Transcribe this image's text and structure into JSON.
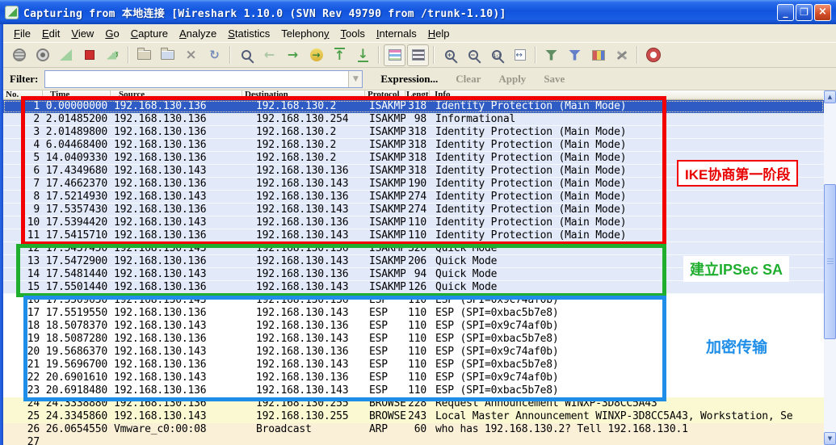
{
  "window": {
    "title": "Capturing from 本地连接    [Wireshark 1.10.0  (SVN Rev 49790 from /trunk-1.10)]",
    "controls": {
      "minimize": "_",
      "maximize": "❐",
      "close": "×"
    }
  },
  "menu": {
    "items": [
      {
        "pre": "",
        "key": "F",
        "post": "ile"
      },
      {
        "pre": "",
        "key": "E",
        "post": "dit"
      },
      {
        "pre": "",
        "key": "V",
        "post": "iew"
      },
      {
        "pre": "",
        "key": "G",
        "post": "o"
      },
      {
        "pre": "",
        "key": "C",
        "post": "apture"
      },
      {
        "pre": "",
        "key": "A",
        "post": "nalyze"
      },
      {
        "pre": "",
        "key": "S",
        "post": "tatistics"
      },
      {
        "pre": "Telephon",
        "key": "y",
        "post": ""
      },
      {
        "pre": "",
        "key": "T",
        "post": "ools"
      },
      {
        "pre": "",
        "key": "I",
        "post": "nternals"
      },
      {
        "pre": "",
        "key": "H",
        "post": "elp"
      }
    ]
  },
  "toolbar": {
    "items": [
      {
        "name": "list-interfaces-icon"
      },
      {
        "name": "capture-options-icon"
      },
      {
        "name": "start-capture-icon"
      },
      {
        "name": "stop-capture-icon"
      },
      {
        "name": "restart-capture-icon"
      },
      {
        "name": "separator"
      },
      {
        "name": "open-file-icon"
      },
      {
        "name": "save-file-icon"
      },
      {
        "name": "close-file-icon"
      },
      {
        "name": "reload-file-icon"
      },
      {
        "name": "separator"
      },
      {
        "name": "find-packet-icon"
      },
      {
        "name": "go-back-icon"
      },
      {
        "name": "go-forward-icon"
      },
      {
        "name": "go-to-packet-icon"
      },
      {
        "name": "go-to-top-icon"
      },
      {
        "name": "go-to-bottom-icon"
      },
      {
        "name": "separator"
      },
      {
        "name": "colorize-icon"
      },
      {
        "name": "auto-scroll-icon"
      },
      {
        "name": "separator"
      },
      {
        "name": "zoom-in-icon"
      },
      {
        "name": "zoom-out-icon"
      },
      {
        "name": "zoom-normal-icon"
      },
      {
        "name": "resize-columns-icon"
      },
      {
        "name": "separator"
      },
      {
        "name": "capture-filter-icon"
      },
      {
        "name": "display-filter-icon"
      },
      {
        "name": "coloring-rules-icon"
      },
      {
        "name": "preferences-icon"
      },
      {
        "name": "separator"
      },
      {
        "name": "help-icon"
      }
    ]
  },
  "filter": {
    "label": "Filter:",
    "value": "",
    "buttons": [
      {
        "label": "Expression...",
        "enabled": true
      },
      {
        "label": "Clear",
        "enabled": false
      },
      {
        "label": "Apply",
        "enabled": false
      },
      {
        "label": "Save",
        "enabled": false
      }
    ]
  },
  "packet_list": {
    "columns": [
      {
        "id": "no",
        "label": "No."
      },
      {
        "id": "time",
        "label": "Time"
      },
      {
        "id": "source",
        "label": "Source"
      },
      {
        "id": "destination",
        "label": "Destination"
      },
      {
        "id": "protocol",
        "label": "Protocol"
      },
      {
        "id": "length",
        "label": "Length"
      },
      {
        "id": "info",
        "label": "Info"
      }
    ],
    "rows": [
      {
        "no": "1",
        "time": "0.00000000",
        "source": "192.168.130.136",
        "destination": "192.168.130.2",
        "protocol": "ISAKMP",
        "length": "318",
        "info": "Identity Protection (Main Mode)",
        "type": "isakmp",
        "selected": true
      },
      {
        "no": "2",
        "time": "2.01485200",
        "source": "192.168.130.136",
        "destination": "192.168.130.254",
        "protocol": "ISAKMP",
        "length": "98",
        "info": "Informational",
        "type": "isakmp"
      },
      {
        "no": "3",
        "time": "2.01489800",
        "source": "192.168.130.136",
        "destination": "192.168.130.2",
        "protocol": "ISAKMP",
        "length": "318",
        "info": "Identity Protection (Main Mode)",
        "type": "isakmp"
      },
      {
        "no": "4",
        "time": "6.04468400",
        "source": "192.168.130.136",
        "destination": "192.168.130.2",
        "protocol": "ISAKMP",
        "length": "318",
        "info": "Identity Protection (Main Mode)",
        "type": "isakmp"
      },
      {
        "no": "5",
        "time": "14.0409330",
        "source": "192.168.130.136",
        "destination": "192.168.130.2",
        "protocol": "ISAKMP",
        "length": "318",
        "info": "Identity Protection (Main Mode)",
        "type": "isakmp"
      },
      {
        "no": "6",
        "time": "17.4349680",
        "source": "192.168.130.143",
        "destination": "192.168.130.136",
        "protocol": "ISAKMP",
        "length": "318",
        "info": "Identity Protection (Main Mode)",
        "type": "isakmp"
      },
      {
        "no": "7",
        "time": "17.4662370",
        "source": "192.168.130.136",
        "destination": "192.168.130.143",
        "protocol": "ISAKMP",
        "length": "190",
        "info": "Identity Protection (Main Mode)",
        "type": "isakmp"
      },
      {
        "no": "8",
        "time": "17.5214930",
        "source": "192.168.130.143",
        "destination": "192.168.130.136",
        "protocol": "ISAKMP",
        "length": "274",
        "info": "Identity Protection (Main Mode)",
        "type": "isakmp"
      },
      {
        "no": "9",
        "time": "17.5357430",
        "source": "192.168.130.136",
        "destination": "192.168.130.143",
        "protocol": "ISAKMP",
        "length": "274",
        "info": "Identity Protection (Main Mode)",
        "type": "isakmp"
      },
      {
        "no": "10",
        "time": "17.5394420",
        "source": "192.168.130.143",
        "destination": "192.168.130.136",
        "protocol": "ISAKMP",
        "length": "110",
        "info": "Identity Protection (Main Mode)",
        "type": "isakmp"
      },
      {
        "no": "11",
        "time": "17.5415710",
        "source": "192.168.130.136",
        "destination": "192.168.130.143",
        "protocol": "ISAKMP",
        "length": "110",
        "info": "Identity Protection (Main Mode)",
        "type": "isakmp"
      },
      {
        "no": "12",
        "time": "17.5437450",
        "source": "192.168.130.143",
        "destination": "192.168.130.136",
        "protocol": "ISAKMP",
        "length": "326",
        "info": "Quick Mode",
        "type": "isakmp"
      },
      {
        "no": "13",
        "time": "17.5472900",
        "source": "192.168.130.136",
        "destination": "192.168.130.143",
        "protocol": "ISAKMP",
        "length": "206",
        "info": "Quick Mode",
        "type": "isakmp"
      },
      {
        "no": "14",
        "time": "17.5481440",
        "source": "192.168.130.143",
        "destination": "192.168.130.136",
        "protocol": "ISAKMP",
        "length": "94",
        "info": "Quick Mode",
        "type": "isakmp"
      },
      {
        "no": "15",
        "time": "17.5501440",
        "source": "192.168.130.136",
        "destination": "192.168.130.143",
        "protocol": "ISAKMP",
        "length": "126",
        "info": "Quick Mode",
        "type": "isakmp"
      },
      {
        "no": "16",
        "time": "17.5509030",
        "source": "192.168.130.143",
        "destination": "192.168.130.136",
        "protocol": "ESP",
        "length": "110",
        "info": "ESP (SPI=0x9c74af0b)",
        "type": "esp"
      },
      {
        "no": "17",
        "time": "17.5519550",
        "source": "192.168.130.136",
        "destination": "192.168.130.143",
        "protocol": "ESP",
        "length": "110",
        "info": "ESP (SPI=0xbac5b7e8)",
        "type": "esp"
      },
      {
        "no": "18",
        "time": "18.5078370",
        "source": "192.168.130.143",
        "destination": "192.168.130.136",
        "protocol": "ESP",
        "length": "110",
        "info": "ESP (SPI=0x9c74af0b)",
        "type": "esp"
      },
      {
        "no": "19",
        "time": "18.5087280",
        "source": "192.168.130.136",
        "destination": "192.168.130.143",
        "protocol": "ESP",
        "length": "110",
        "info": "ESP (SPI=0xbac5b7e8)",
        "type": "esp"
      },
      {
        "no": "20",
        "time": "19.5686370",
        "source": "192.168.130.143",
        "destination": "192.168.130.136",
        "protocol": "ESP",
        "length": "110",
        "info": "ESP (SPI=0x9c74af0b)",
        "type": "esp"
      },
      {
        "no": "21",
        "time": "19.5696700",
        "source": "192.168.130.136",
        "destination": "192.168.130.143",
        "protocol": "ESP",
        "length": "110",
        "info": "ESP (SPI=0xbac5b7e8)",
        "type": "esp"
      },
      {
        "no": "22",
        "time": "20.6901610",
        "source": "192.168.130.143",
        "destination": "192.168.130.136",
        "protocol": "ESP",
        "length": "110",
        "info": "ESP (SPI=0x9c74af0b)",
        "type": "esp"
      },
      {
        "no": "23",
        "time": "20.6918480",
        "source": "192.168.130.136",
        "destination": "192.168.130.143",
        "protocol": "ESP",
        "length": "110",
        "info": "ESP (SPI=0xbac5b7e8)",
        "type": "esp"
      },
      {
        "no": "24",
        "time": "24.3338880",
        "source": "192.168.130.136",
        "destination": "192.168.130.255",
        "protocol": "BROWSER",
        "length": "228",
        "info": "Request Announcement WINXP-3D8CC5A43",
        "type": "browser"
      },
      {
        "no": "25",
        "time": "24.3345860",
        "source": "192.168.130.143",
        "destination": "192.168.130.255",
        "protocol": "BROWSER",
        "length": "243",
        "info": "Local Master Announcement WINXP-3D8CC5A43, Workstation, Se",
        "type": "browser"
      },
      {
        "no": "26",
        "time": "26.0654550",
        "source": "Vmware_c0:00:08",
        "destination": "Broadcast",
        "protocol": "ARP",
        "length": "60",
        "info": "who has 192.168.130.2?  Tell 192.168.130.1",
        "type": "arp"
      },
      {
        "no": "27",
        "time": "",
        "source": "",
        "destination": "",
        "protocol": "",
        "length": "",
        "info": "",
        "type": "arp",
        "partial": true
      }
    ]
  },
  "annotations": {
    "boxes": [
      {
        "name": "ike-phase1",
        "color": "#f20000",
        "label": "IKE协商第一阶段"
      },
      {
        "name": "ipsec-sa",
        "color": "#1fae2e",
        "label": "建立IPSec SA"
      },
      {
        "name": "encrypted",
        "color": "#1e8ee8",
        "label": "加密传输"
      }
    ]
  },
  "colors": {
    "row_isakmp": "#e2e9f9",
    "row_esp": "#ffffff",
    "row_browser": "#fbf9d2",
    "row_arp": "#faf0d8",
    "row_selected_bg": "#2e5bc4",
    "row_selected_text": "#ffffff",
    "row_border": "#f6f9ff",
    "titlebar_blue": "#1254dd"
  }
}
